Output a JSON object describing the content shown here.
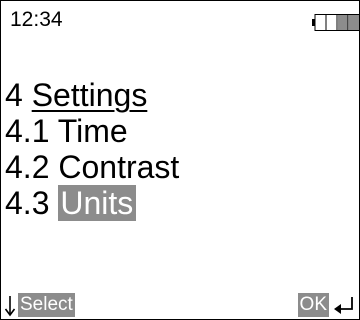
{
  "status_bar": {
    "time": "12:34",
    "battery_icon": "battery-icon",
    "battery_level": 0.4
  },
  "menu": {
    "title_number": "4",
    "title_label": "Settings",
    "items": [
      {
        "number": "4.1",
        "label": "Time"
      },
      {
        "number": "4.2",
        "label": "Contrast"
      },
      {
        "number": "4.3",
        "label": "Units"
      }
    ],
    "selected_index": 2
  },
  "softkeys": {
    "left_icon": "down-arrow-icon",
    "left_label": "Select",
    "right_label": "OK",
    "right_icon": "enter-icon"
  },
  "colors": {
    "highlight": "#8c8c8c",
    "foreground": "#000000",
    "background": "#ffffff"
  }
}
